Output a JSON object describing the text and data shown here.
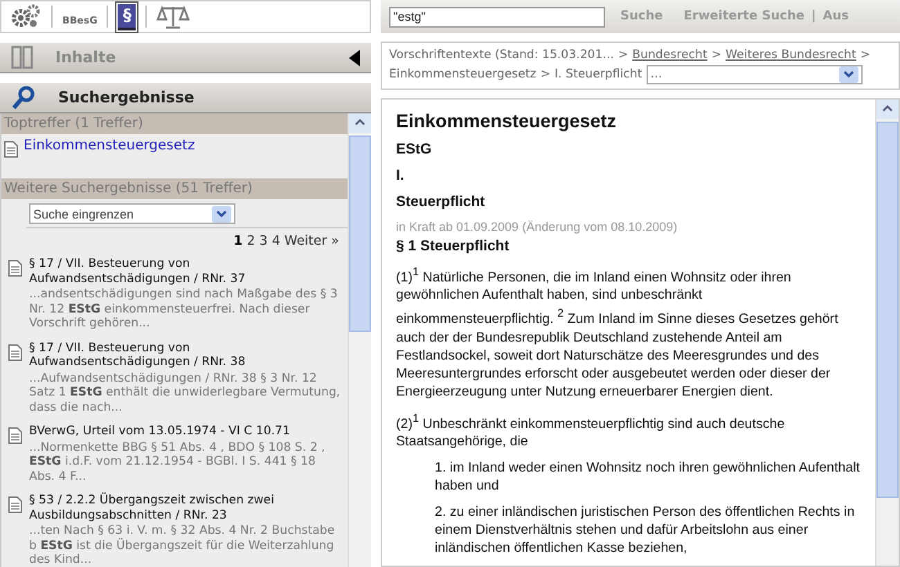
{
  "toolbar": {
    "items": [
      {
        "kind": "gears",
        "selected": false
      },
      {
        "kind": "bbesg",
        "label": "BBesG",
        "selected": false
      },
      {
        "kind": "paragraph",
        "label": "§",
        "selected": true
      },
      {
        "kind": "scales",
        "selected": false
      }
    ]
  },
  "panels": [
    {
      "kind": "contents",
      "title": "Inhalte",
      "expanded": false
    },
    {
      "kind": "search",
      "title": "Suchergebnisse",
      "expanded": true
    }
  ],
  "results": {
    "top_header": "Toptreffer (1 Treffer)",
    "top_hits": [
      "Einkommensteuergesetz"
    ],
    "more_header": "Weitere Suchergebnisse (51 Treffer)",
    "filter": {
      "placeholder": "Suche eingrenzen"
    },
    "pages": [
      {
        "label": "1",
        "selected": true
      },
      {
        "label": "2",
        "selected": false
      },
      {
        "label": "3",
        "selected": false
      },
      {
        "label": "4",
        "selected": false
      }
    ],
    "next": "Weiter »",
    "items": [
      {
        "title": "§ 17 / VII. Besteuerung von Aufwandsentschädigungen / RNr. 37",
        "snippet": "...andsentschädigungen sind nach Maßgabe des § 3 Nr. 12 **EStG** einkommensteuerfrei. Nach dieser Vorschrift gehören..."
      },
      {
        "title": "§ 17 / VII. Besteuerung von Aufwandsentschädigungen / RNr. 38",
        "snippet": "...Aufwandsentschädigungen / RNr. 38 § 3 Nr. 12 Satz 1 **EStG** enthält die unwiderlegbare Vermutung, dass die nach..."
      },
      {
        "title": "BVerwG, Urteil vom 13.05.1974 - VI C 10.71",
        "snippet": "...Normenkette BBG § 51 Abs. 4 , BDO § 108 S. 2 , **EStG** i.d.F. vom 21.12.1954 - BGBl. I S. 441 § 18 Abs. 4 F..."
      },
      {
        "title": "§ 53 / 2.2.2 Übergangszeit zwischen zwei Ausbildungsabschnitten / RNr. 23",
        "snippet": "...ten Nach § 63 i. V. m. § 32 Abs. 4 Nr. 2 Buchstabe b **EStG** ist die Übergangszeit für die Weiterzahlung des Kind..."
      }
    ]
  },
  "searchbar": {
    "value": "\"estg\"",
    "button": "Suche",
    "links": [
      {
        "kind": "link",
        "label": "Erweiterte Suche"
      },
      {
        "kind": "divider",
        "label": "|"
      },
      {
        "kind": "link",
        "label": "Aus"
      }
    ]
  },
  "breadcrumb": {
    "items": [
      {
        "label": "Vorschriftentexte (Stand: 15.03.201...",
        "link": false
      },
      {
        "separator": ">",
        "label": "Bundesrecht",
        "link": true
      },
      {
        "separator": ">",
        "label": "Weiteres Bundesrecht",
        "link": true
      },
      {
        "separator": ">",
        "label": "Einkommensteuergesetz",
        "link": false
      },
      {
        "separator": ">",
        "label": "I. Steuerpflicht",
        "link": false
      }
    ],
    "select": "..."
  },
  "document": {
    "title": "Einkommensteuergesetz",
    "abbreviation": "EStG",
    "section_number": "I.",
    "section_title": "Steuerpflicht",
    "validity": "in Kraft ab 01.09.2009 (Änderung vom 08.10.2009)",
    "paragraph_title": "§ 1 Steuerpflicht",
    "blocks": [
      {
        "kind": "para",
        "text": "(1)$^{1}$ Natürliche Personen, die im Inland einen Wohnsitz oder ihren gewöhnlichen Aufenthalt haben, sind unbeschränkt einkommensteuerpflichtig. $^{2}$ Zum Inland im Sinne dieses Gesetzes gehört auch der der Bundesrepublik Deutschland zustehende Anteil am Festlandsockel, soweit dort Naturschätze des Meeresgrundes und des Meeresuntergrundes erforscht oder ausgebeutet werden oder dieser der Energieerzeugung unter Nutzung erneuerbarer Energien dient."
      },
      {
        "kind": "para",
        "text": "(2)$^{1}$ Unbeschränkt einkommensteuerpflichtig sind auch deutsche Staatsangehörige, die"
      },
      {
        "kind": "item",
        "text": "1. im Inland weder einen Wohnsitz noch ihren gewöhnlichen Aufenthalt haben und"
      },
      {
        "kind": "item",
        "text": "2. zu einer inländischen juristischen Person des öffentlichen Rechts in einem Dienstverhältnis stehen und dafür Arbeitslohn aus einer inländischen öffentlichen Kasse beziehen,"
      }
    ]
  }
}
